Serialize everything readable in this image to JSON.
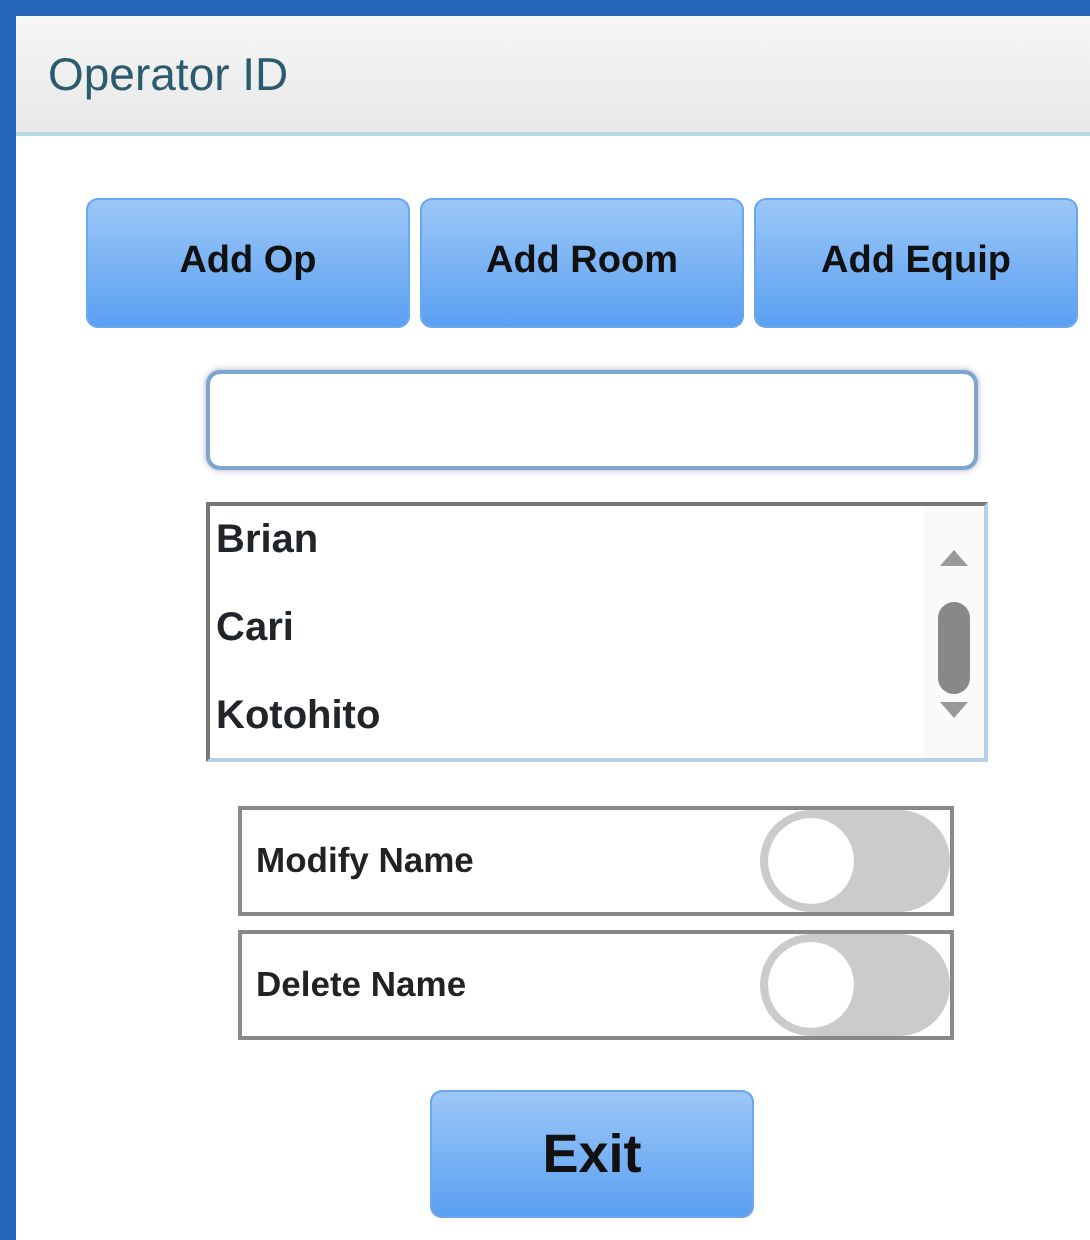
{
  "window": {
    "title": "Operator ID"
  },
  "buttons": [
    {
      "label": "Add Op"
    },
    {
      "label": "Add Room"
    },
    {
      "label": "Add Equip"
    }
  ],
  "names": [
    {
      "label": "Brian",
      "selected": false
    },
    {
      "label": "Cari",
      "selected": false
    },
    {
      "label": "Kotohito",
      "selected": false
    }
  ],
  "toggles": [
    {
      "label": "Modify Name",
      "on": false
    },
    {
      "label": "Delete Name",
      "on": false
    }
  ],
  "exit_button": {
    "label": "Exit"
  }
}
